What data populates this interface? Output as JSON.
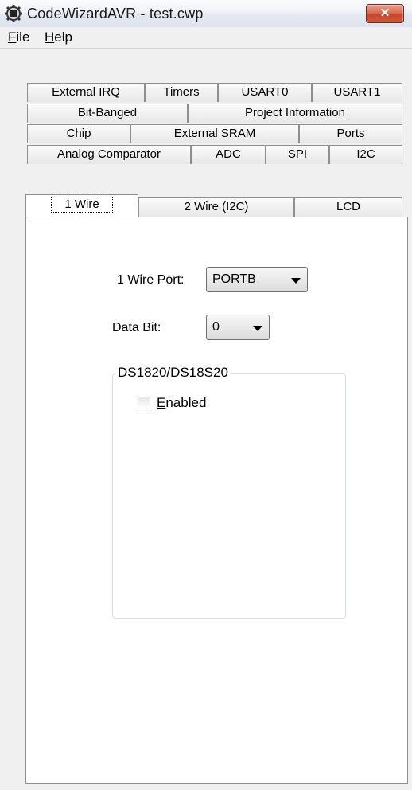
{
  "window": {
    "title": "CodeWizardAVR - test.cwp",
    "app_icon": "gear-chip-icon",
    "close_glyph": "✕"
  },
  "menu": {
    "file": {
      "accel": "F",
      "rest": "ile"
    },
    "help": {
      "accel": "H",
      "rest": "elp"
    }
  },
  "tabs": {
    "row1": [
      "External IRQ",
      "Timers",
      "USART0",
      "USART1"
    ],
    "row2": [
      "Bit-Banged",
      "Project Information"
    ],
    "row3": [
      "Chip",
      "External SRAM",
      "Ports"
    ],
    "row4": [
      "Analog Comparator",
      "ADC",
      "SPI",
      "I2C"
    ],
    "row5": [
      "1 Wire",
      "2 Wire (I2C)",
      "LCD"
    ],
    "selected": "1 Wire"
  },
  "one_wire": {
    "port_label": "1 Wire Port:",
    "port_value": "PORTB",
    "bit_label": "Data Bit:",
    "bit_value": "0",
    "group_title": "DS1820/DS18S20",
    "enabled_accel": "E",
    "enabled_rest": "nabled",
    "enabled_checked": false
  }
}
